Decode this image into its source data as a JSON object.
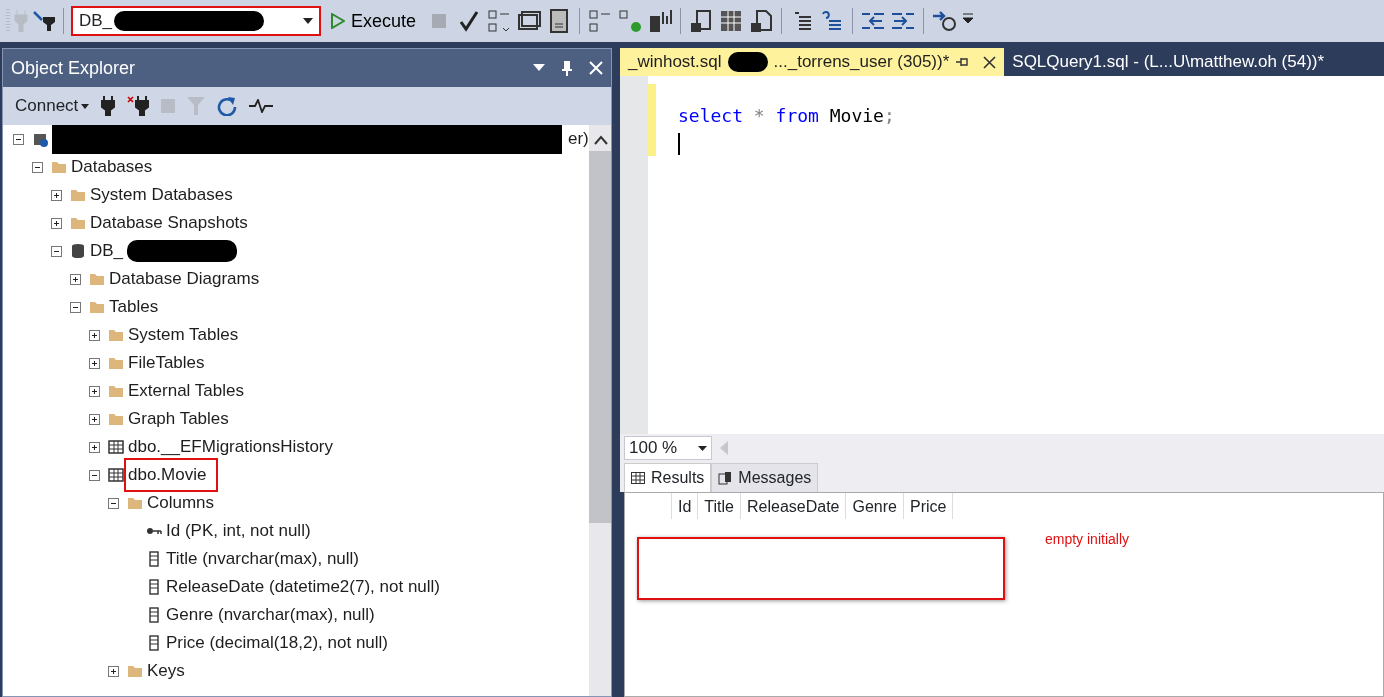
{
  "toolbar": {
    "database": {
      "prefix": "DB_",
      "redacted": true,
      "highlighted": true
    },
    "execute_label": "Execute"
  },
  "object_explorer": {
    "title": "Object Explorer",
    "connect_label": "Connect",
    "tree": [
      {
        "label": "er)",
        "kind": "server",
        "redacted": true,
        "expanded": true,
        "highlighted": false,
        "children": [
          {
            "label": "Databases",
            "kind": "folder",
            "expanded": true,
            "highlighted": false,
            "children": [
              {
                "label": "System Databases",
                "kind": "folder",
                "expanded": false,
                "highlighted": false
              },
              {
                "label": "Database Snapshots",
                "kind": "folder",
                "expanded": false,
                "highlighted": false
              },
              {
                "label": "DB_",
                "kind": "database",
                "redacted": true,
                "expanded": true,
                "highlighted": false,
                "children": [
                  {
                    "label": "Database Diagrams",
                    "kind": "folder",
                    "expanded": false,
                    "highlighted": false
                  },
                  {
                    "label": "Tables",
                    "kind": "folder",
                    "expanded": true,
                    "highlighted": false,
                    "children": [
                      {
                        "label": "System Tables",
                        "kind": "folder",
                        "expanded": false,
                        "highlighted": false
                      },
                      {
                        "label": "FileTables",
                        "kind": "folder",
                        "expanded": false,
                        "highlighted": false
                      },
                      {
                        "label": "External Tables",
                        "kind": "folder",
                        "expanded": false,
                        "highlighted": false
                      },
                      {
                        "label": "Graph Tables",
                        "kind": "folder",
                        "expanded": false,
                        "highlighted": false
                      },
                      {
                        "label": "dbo.__EFMigrationsHistory",
                        "kind": "table",
                        "expanded": false,
                        "highlighted": false
                      },
                      {
                        "label": "dbo.Movie",
                        "kind": "table",
                        "expanded": true,
                        "highlighted": true,
                        "children": [
                          {
                            "label": "Columns",
                            "kind": "folder",
                            "expanded": true,
                            "highlighted": false,
                            "children": [
                              {
                                "label": "Id (PK, int, not null)",
                                "kind": "key",
                                "highlighted": false
                              },
                              {
                                "label": "Title (nvarchar(max), null)",
                                "kind": "column",
                                "highlighted": false
                              },
                              {
                                "label": "ReleaseDate (datetime2(7), not null)",
                                "kind": "column",
                                "highlighted": false
                              },
                              {
                                "label": "Genre (nvarchar(max), null)",
                                "kind": "column",
                                "highlighted": false
                              },
                              {
                                "label": "Price (decimal(18,2), not null)",
                                "kind": "column",
                                "highlighted": false
                              }
                            ]
                          },
                          {
                            "label": "Keys",
                            "kind": "folder",
                            "expanded": false,
                            "highlighted": false
                          }
                        ]
                      }
                    ]
                  }
                ]
              }
            ]
          }
        ]
      }
    ]
  },
  "editor": {
    "tabs": [
      {
        "label": "_winhost.sql",
        "label_after_redaction": "..._torrens_user (305))*",
        "selected": true
      },
      {
        "label": "SQLQuery1.sql - (L...U\\matthew.oh (54))*",
        "selected": false
      }
    ],
    "code": [
      {
        "text": "select",
        "kind": "keyword"
      },
      {
        "text": " * ",
        "kind": "operator"
      },
      {
        "text": "from",
        "kind": "keyword"
      },
      {
        "text": " Movie",
        "kind": "identifier"
      },
      {
        "text": ";",
        "kind": "operator"
      }
    ]
  },
  "zoom": "100 %",
  "results": {
    "tabs": [
      {
        "label": "Results",
        "selected": true
      },
      {
        "label": "Messages",
        "selected": false
      }
    ],
    "columns": [
      "Id",
      "Title",
      "ReleaseDate",
      "Genre",
      "Price"
    ],
    "annotation": {
      "text": "empty initially"
    }
  }
}
